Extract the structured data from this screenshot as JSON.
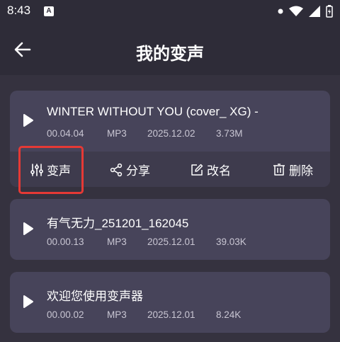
{
  "status_bar": {
    "time": "8:43",
    "app_icon_letter": "A"
  },
  "header": {
    "title": "我的变声",
    "back_icon": "arrow-left-icon"
  },
  "recordings": [
    {
      "name": "WINTER WITHOUT YOU (cover_ XG) -",
      "duration": "00.04.04",
      "format": "MP3",
      "date": "2025.12.02",
      "size": "3.73M",
      "expanded": true
    },
    {
      "name": "有气无力_251201_162045",
      "duration": "00.00.13",
      "format": "MP3",
      "date": "2025.12.01",
      "size": "39.03K",
      "expanded": false
    },
    {
      "name": "欢迎您使用变声器",
      "duration": "00.00.02",
      "format": "MP3",
      "date": "2025.12.01",
      "size": "8.24K",
      "expanded": false
    }
  ],
  "actions": {
    "voice_change": {
      "label": "变声",
      "icon": "sliders-icon"
    },
    "share": {
      "label": "分享",
      "icon": "share-icon"
    },
    "rename": {
      "label": "改名",
      "icon": "edit-icon"
    },
    "delete": {
      "label": "删除",
      "icon": "trash-icon"
    }
  },
  "colors": {
    "background": "#35323f",
    "card": "#47445a",
    "actions_bar": "#3e3b4d",
    "highlight": "#e53935"
  }
}
